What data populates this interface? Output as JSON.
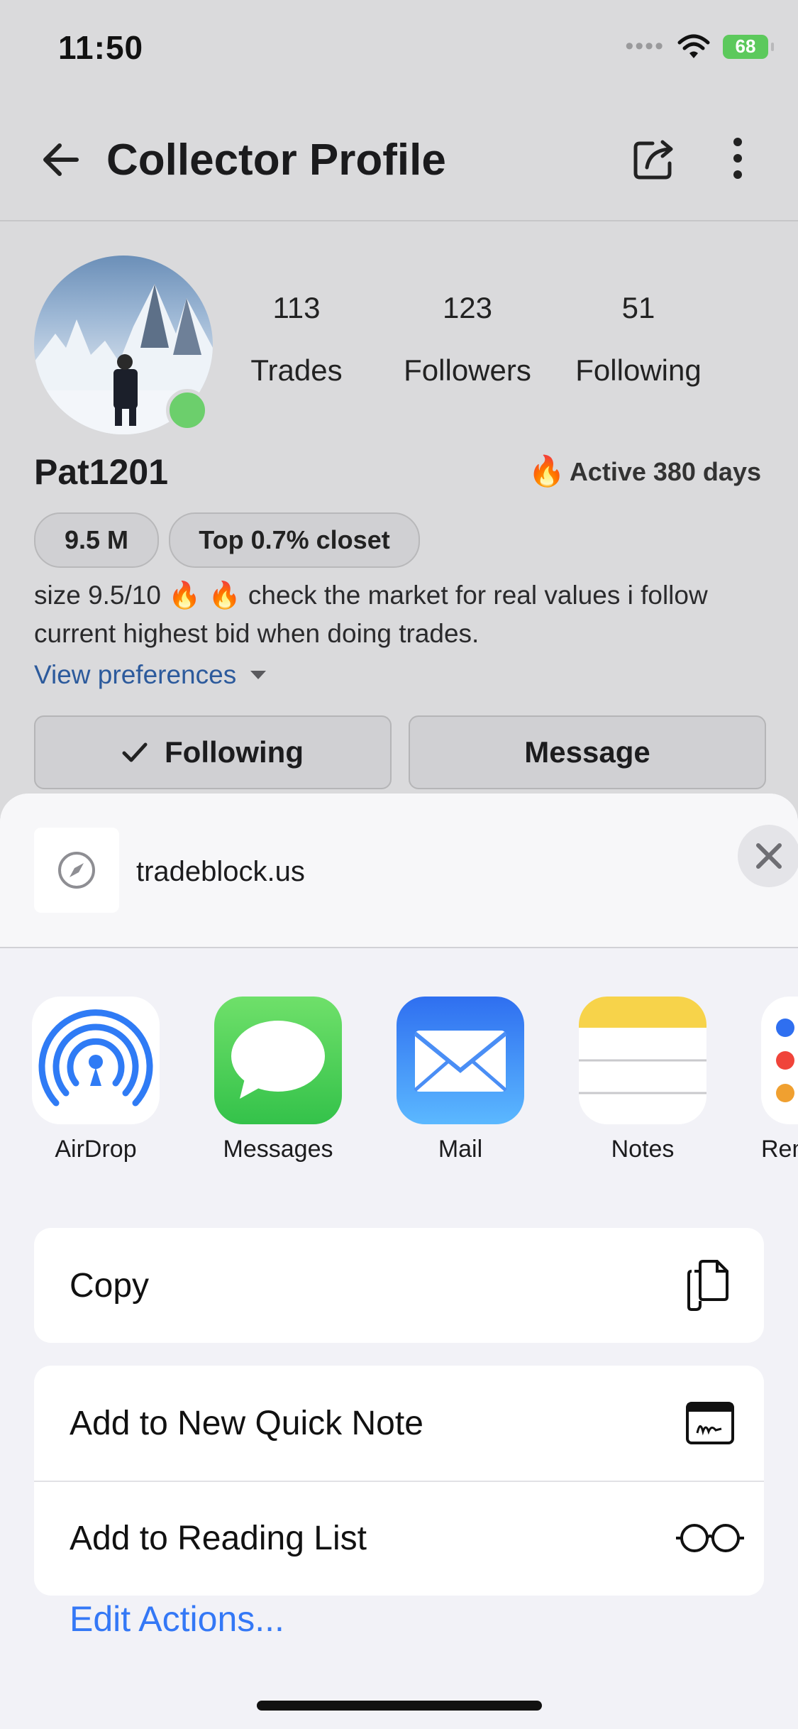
{
  "status_bar": {
    "time": "11:50",
    "signal": "••••",
    "battery": "68"
  },
  "header": {
    "title": "Collector Profile"
  },
  "profile": {
    "username": "Pat1201",
    "active_label": "Active 380 days",
    "fire_glyph": "🔥",
    "stats": [
      {
        "value": "113",
        "label": "Trades"
      },
      {
        "value": "123",
        "label": "Followers"
      },
      {
        "value": "51",
        "label": "Following"
      }
    ],
    "chips": [
      "9.5 M",
      "Top 0.7% closet"
    ],
    "bio": "size 9.5/10 🔥 🔥 check the market for real values i follow current highest bid when doing trades.",
    "preferences_link": "View preferences",
    "buttons": {
      "following": "Following",
      "message": "Message"
    }
  },
  "share_sheet": {
    "site": "tradeblock.us",
    "apps": [
      {
        "name": "AirDrop",
        "icon": "airdrop-icon"
      },
      {
        "name": "Messages",
        "icon": "messages-icon"
      },
      {
        "name": "Mail",
        "icon": "mail-icon"
      },
      {
        "name": "Notes",
        "icon": "notes-icon"
      },
      {
        "name": "Rem",
        "icon": "reminders-icon"
      }
    ],
    "actions": [
      {
        "label": "Copy",
        "icon": "copy-icon"
      },
      {
        "label": "Add to New Quick Note",
        "icon": "quick-note-icon"
      },
      {
        "label": "Add to Reading List",
        "icon": "reading-glasses-icon"
      }
    ],
    "edit_actions": "Edit Actions..."
  },
  "colors": {
    "accent": "#3478f6",
    "link": "#2c5a9c",
    "online": "#6ccf6c"
  }
}
